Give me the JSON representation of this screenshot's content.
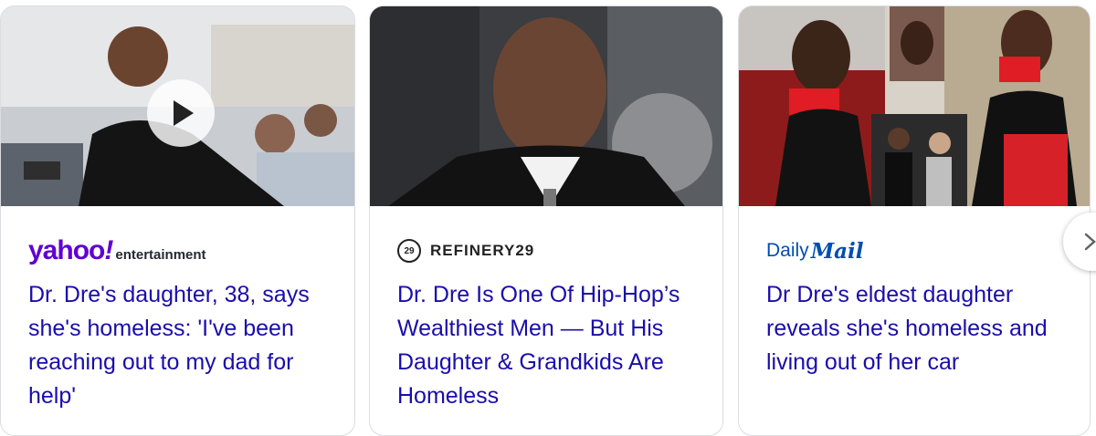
{
  "cards": [
    {
      "publisher": {
        "logo_main": "yahoo",
        "logo_bang": "!",
        "logo_sub": "entertainment"
      },
      "headline": "Dr. Dre's daughter, 38, says she's homeless: 'I've been reaching out to my dad for help'",
      "has_video": true
    },
    {
      "publisher": {
        "name": "REFINERY29",
        "icon_text": "29"
      },
      "headline": "Dr. Dre Is One Of Hip-Hop’s Wealthiest Men — But His Daughter & Grandkids Are Homeless",
      "has_video": false
    },
    {
      "publisher": {
        "logo_part1": "Daily",
        "logo_part2": "Mail"
      },
      "headline": "Dr Dre's eldest daughter reveals she's homeless and living out of her car",
      "has_video": false
    }
  ],
  "colors": {
    "link": "#1a0dab",
    "yahoo": "#6001d2",
    "dailymail": "#004db3"
  },
  "icons": {
    "video": "play-icon",
    "next": "chevron-right-icon"
  }
}
